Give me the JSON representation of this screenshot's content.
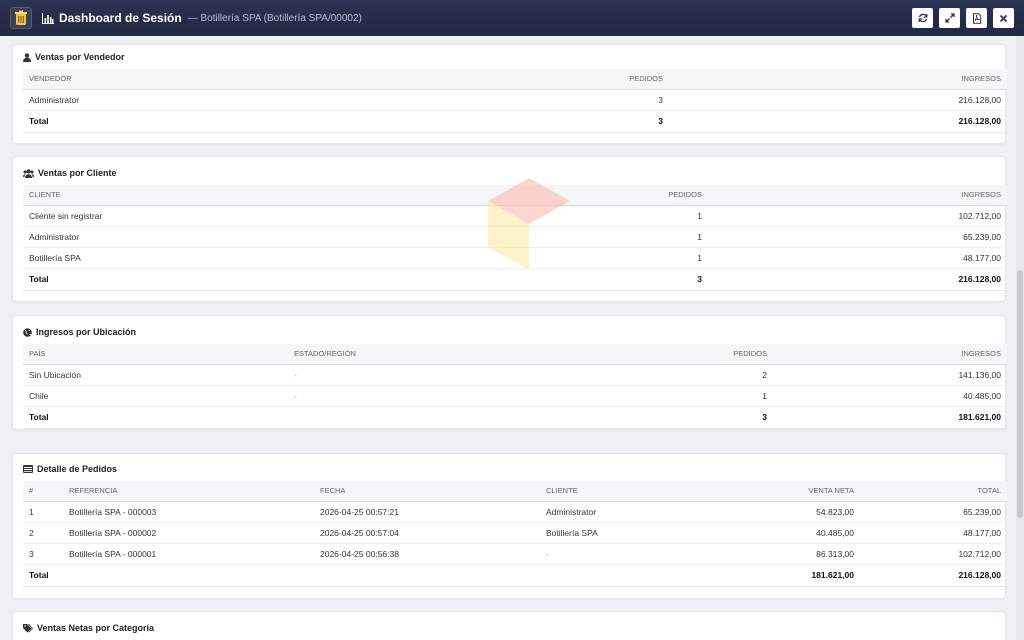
{
  "header": {
    "title": "Dashboard de Sesión",
    "subtitle": "— Botillería SPA (Botillería SPA/00002)",
    "buttons": [
      {
        "icon": "refresh-icon"
      },
      {
        "icon": "expand-icon"
      },
      {
        "icon": "pdf-icon"
      },
      {
        "icon": "close-icon"
      }
    ]
  },
  "vendedor": {
    "title": "Ventas por Vendedor",
    "headers": [
      "VENDEDOR",
      "PEDIDOS",
      "INGRESOS"
    ],
    "rows": [
      [
        "Administrator",
        "3",
        "216.128,00"
      ]
    ],
    "total": [
      "Total",
      "3",
      "216.128,00"
    ]
  },
  "cliente": {
    "title": "Ventas por Cliente",
    "headers": [
      "CLIENTE",
      "PEDIDOS",
      "INGRESOS"
    ],
    "rows": [
      [
        "Cliente sin registrar",
        "1",
        "102.712,00"
      ],
      [
        "Administrator",
        "1",
        "65.239,00"
      ],
      [
        "Botillería SPA",
        "1",
        "48.177,00"
      ]
    ],
    "total": [
      "Total",
      "3",
      "216.128,00"
    ]
  },
  "ubicacion": {
    "title": "Ingresos por Ubicación",
    "headers": [
      "PAÍS",
      "ESTADO/REGIÓN",
      "PEDIDOS",
      "INGRESOS"
    ],
    "rows": [
      [
        "Sin Ubicación",
        "-",
        "2",
        "141.136,00"
      ],
      [
        "Chile",
        "-",
        "1",
        "40.485,00"
      ]
    ],
    "total": [
      "Total",
      "",
      "3",
      "181.621,00"
    ]
  },
  "pedidos": {
    "title": "Detalle de Pedidos",
    "headers": [
      "#",
      "REFERENCIA",
      "FECHA",
      "CLIENTE",
      "VENTA NETA",
      "TOTAL"
    ],
    "rows": [
      [
        "1",
        "Botillería SPA - 000003",
        "2026-04-25 00:57:21",
        "Administrator",
        "54.823,00",
        "65.239,00"
      ],
      [
        "2",
        "Botillería SPA - 000002",
        "2026-04-25 00:57:04",
        "Botillería SPA",
        "40.485,00",
        "48.177,00"
      ],
      [
        "3",
        "Botillería SPA - 000001",
        "2026-04-25 00:56:38",
        "-",
        "86.313,00",
        "102.712,00"
      ]
    ],
    "total": [
      "Total",
      "",
      "",
      "",
      "181.621,00",
      "216.128,00"
    ]
  },
  "categoria": {
    "title": "Ventas Netas por Categoría"
  }
}
